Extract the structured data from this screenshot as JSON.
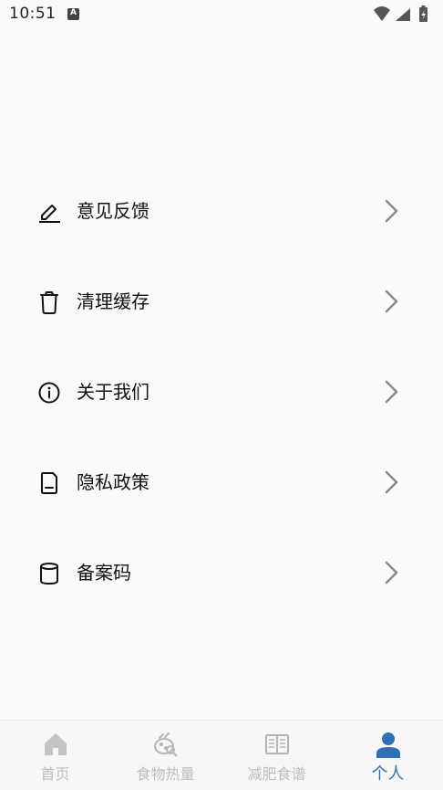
{
  "status_bar": {
    "time": "10:51",
    "notification_letter": "A"
  },
  "menu": {
    "items": [
      {
        "label": "意见反馈",
        "icon": "edit-icon"
      },
      {
        "label": "清理缓存",
        "icon": "trash-icon"
      },
      {
        "label": "关于我们",
        "icon": "info-icon"
      },
      {
        "label": "隐私政策",
        "icon": "document-icon"
      },
      {
        "label": "备案码",
        "icon": "database-icon"
      }
    ]
  },
  "tabbar": {
    "tabs": [
      {
        "label": "首页",
        "icon": "home-icon",
        "active": false
      },
      {
        "label": "食物热量",
        "icon": "food-calories-icon",
        "active": false
      },
      {
        "label": "减肥食谱",
        "icon": "recipe-book-icon",
        "active": false
      },
      {
        "label": "个人",
        "icon": "person-icon",
        "active": true
      }
    ]
  },
  "colors": {
    "background": "#fafafa",
    "accent": "#2f6fb3",
    "inactive_tab": "#bdbdbd",
    "chevron": "#8a8a8a"
  }
}
